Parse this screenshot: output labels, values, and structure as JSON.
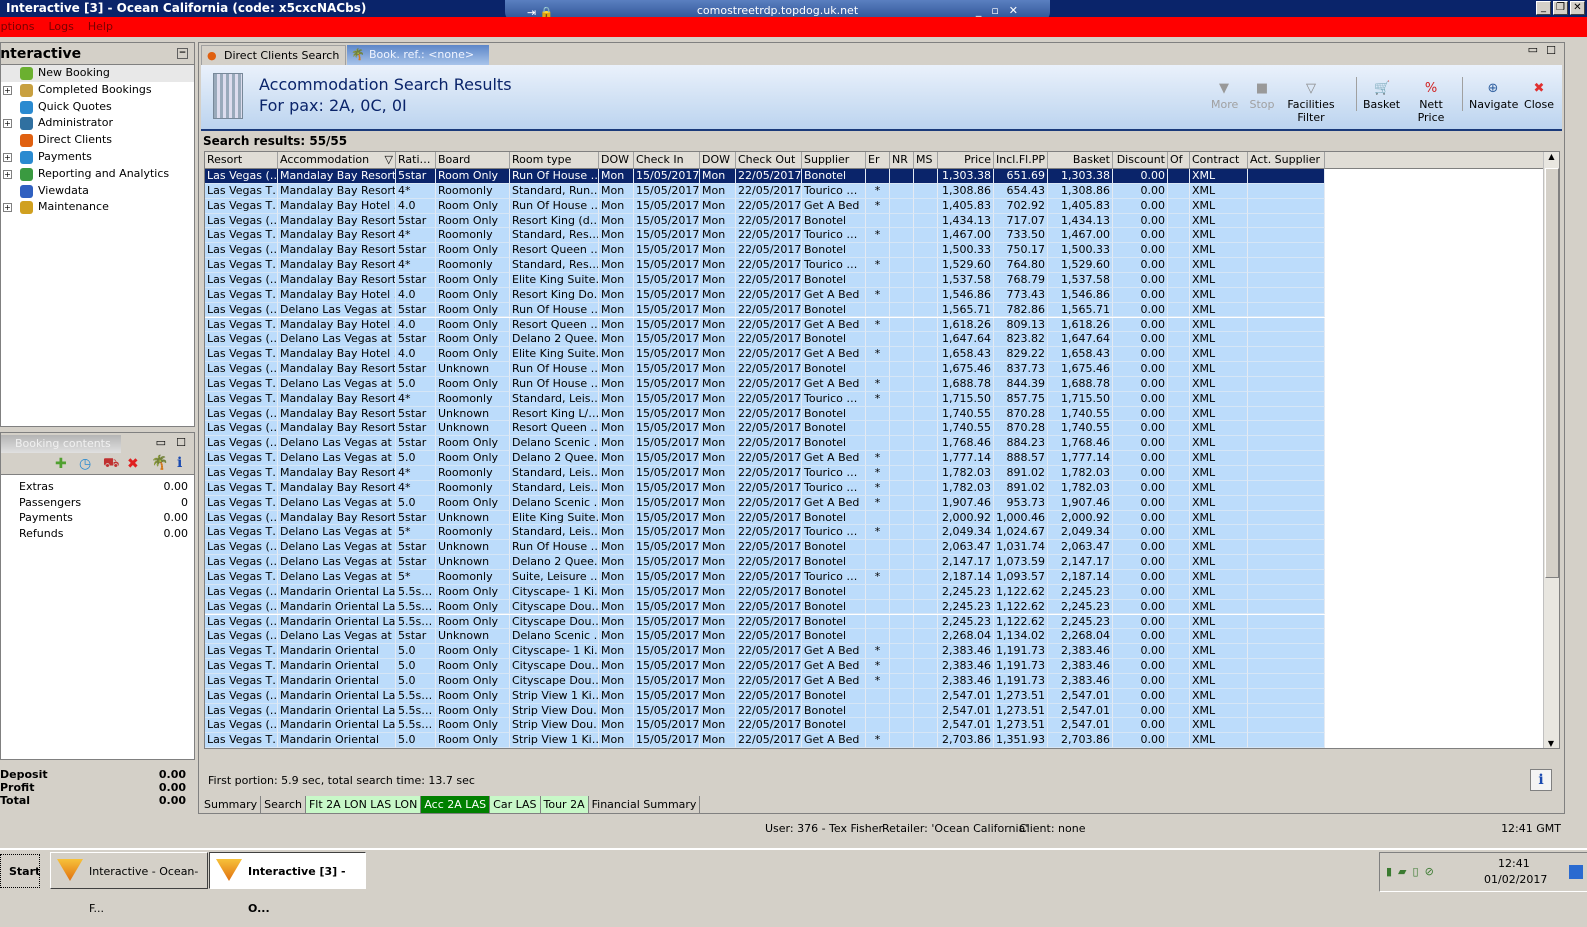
{
  "window": {
    "title": "Interactive [3] - Ocean California (code: x5cxcNACbs)",
    "rdp_host": "comostreetrdp.topdog.uk.net"
  },
  "menu": [
    "Options",
    "Logs",
    "Help"
  ],
  "sidebar": {
    "title": "Interactive",
    "items": [
      {
        "label": "New Booking",
        "expandable": false,
        "icon": "palm-tree-icon"
      },
      {
        "label": "Completed Bookings",
        "expandable": true,
        "icon": "palm-tree-money-icon"
      },
      {
        "label": "Quick Quotes",
        "expandable": false,
        "icon": "clock-globe-icon"
      },
      {
        "label": "Administrator",
        "expandable": true,
        "icon": "runner-icon"
      },
      {
        "label": "Direct Clients",
        "expandable": false,
        "icon": "person-icon"
      },
      {
        "label": "Payments",
        "expandable": true,
        "icon": "dollar-card-icon"
      },
      {
        "label": "Reporting and Analytics",
        "expandable": true,
        "icon": "report-icon"
      },
      {
        "label": "Viewdata",
        "expandable": false,
        "icon": "globe-icon"
      },
      {
        "label": "Maintenance",
        "expandable": true,
        "icon": "box-icon"
      }
    ]
  },
  "booking_contents": {
    "tab": "Booking contents",
    "rows": [
      [
        "Extras",
        "0.00"
      ],
      [
        "Passengers",
        "0"
      ],
      [
        "Payments",
        "0.00"
      ],
      [
        "Refunds",
        "0.00"
      ]
    ]
  },
  "totals": [
    [
      "Deposit",
      "0.00"
    ],
    [
      "Profit",
      "0.00"
    ],
    [
      "Total",
      "0.00"
    ]
  ],
  "tabs": [
    {
      "label": "Direct Clients Search",
      "active": false
    },
    {
      "label": "Book. ref.: <none>",
      "active": true
    }
  ],
  "header": {
    "title": "Accommodation Search Results",
    "subtitle": "For pax: 2A, 0C, 0I"
  },
  "toolbar": [
    {
      "label": "More",
      "icon": "chevron-down-icon",
      "enabled": false
    },
    {
      "label": "Stop",
      "icon": "stop-icon",
      "enabled": false
    },
    {
      "label": "Facilities Filter",
      "icon": "filter-icon",
      "enabled": true
    },
    {
      "label": "Basket",
      "icon": "basket-icon",
      "enabled": true
    },
    {
      "label": "Nett Price",
      "icon": "nett-price-icon",
      "enabled": true
    },
    {
      "label": "Navigate",
      "icon": "compass-icon",
      "enabled": true
    },
    {
      "label": "Close",
      "icon": "close-icon",
      "enabled": true
    }
  ],
  "search_results": "Search results: 55/55",
  "columns": [
    "Resort",
    "Accommodation",
    "Rati…",
    "Board",
    "Room type",
    "DOW",
    "Check In",
    "DOW",
    "Check Out",
    "Supplier",
    "Er",
    "NR",
    "MS",
    "Price",
    "Incl.Fl.PP",
    "Basket",
    "Discount",
    "Of",
    "Contract",
    "Act. Supplier"
  ],
  "rows": [
    [
      "Las Vegas (…",
      "Mandalay Bay Resort…",
      "5star",
      "Room Only",
      "Run Of House …",
      "Mon",
      "15/05/2017",
      "Mon",
      "22/05/2017",
      "Bonotel",
      "",
      "",
      "",
      "1,303.38",
      "651.69",
      "1,303.38",
      "0.00",
      "",
      "XML",
      ""
    ],
    [
      "Las Vegas T…",
      "Mandalay Bay Resort",
      "4*",
      "Roomonly",
      "Standard, Run…",
      "Mon",
      "15/05/2017",
      "Mon",
      "22/05/2017",
      "Tourico …",
      "*",
      "",
      "",
      "1,308.86",
      "654.43",
      "1,308.86",
      "0.00",
      "",
      "XML",
      ""
    ],
    [
      "Las Vegas T…",
      "Mandalay Bay Hotel …",
      "4.0",
      "Room Only",
      "Run Of House …",
      "Mon",
      "15/05/2017",
      "Mon",
      "22/05/2017",
      "Get A Bed",
      "*",
      "",
      "",
      "1,405.83",
      "702.92",
      "1,405.83",
      "0.00",
      "",
      "XML",
      ""
    ],
    [
      "Las Vegas (…",
      "Mandalay Bay Resort…",
      "5star",
      "Room Only",
      "Resort King (d…",
      "Mon",
      "15/05/2017",
      "Mon",
      "22/05/2017",
      "Bonotel",
      "",
      "",
      "",
      "1,434.13",
      "717.07",
      "1,434.13",
      "0.00",
      "",
      "XML",
      ""
    ],
    [
      "Las Vegas T…",
      "Mandalay Bay Resort",
      "4*",
      "Roomonly",
      "Standard, Res…",
      "Mon",
      "15/05/2017",
      "Mon",
      "22/05/2017",
      "Tourico …",
      "*",
      "",
      "",
      "1,467.00",
      "733.50",
      "1,467.00",
      "0.00",
      "",
      "XML",
      ""
    ],
    [
      "Las Vegas (…",
      "Mandalay Bay Resort…",
      "5star",
      "Room Only",
      "Resort Queen …",
      "Mon",
      "15/05/2017",
      "Mon",
      "22/05/2017",
      "Bonotel",
      "",
      "",
      "",
      "1,500.33",
      "750.17",
      "1,500.33",
      "0.00",
      "",
      "XML",
      ""
    ],
    [
      "Las Vegas T…",
      "Mandalay Bay Resort",
      "4*",
      "Roomonly",
      "Standard, Res…",
      "Mon",
      "15/05/2017",
      "Mon",
      "22/05/2017",
      "Tourico …",
      "*",
      "",
      "",
      "1,529.60",
      "764.80",
      "1,529.60",
      "0.00",
      "",
      "XML",
      ""
    ],
    [
      "Las Vegas (…",
      "Mandalay Bay Resort…",
      "5star",
      "Room Only",
      "Elite King Suite…",
      "Mon",
      "15/05/2017",
      "Mon",
      "22/05/2017",
      "Bonotel",
      "",
      "",
      "",
      "1,537.58",
      "768.79",
      "1,537.58",
      "0.00",
      "",
      "XML",
      ""
    ],
    [
      "Las Vegas T…",
      "Mandalay Bay Hotel …",
      "4.0",
      "Room Only",
      "Resort King Do…",
      "Mon",
      "15/05/2017",
      "Mon",
      "22/05/2017",
      "Get A Bed",
      "*",
      "",
      "",
      "1,546.86",
      "773.43",
      "1,546.86",
      "0.00",
      "",
      "XML",
      ""
    ],
    [
      "Las Vegas (…",
      "Delano Las Vegas at …",
      "5star",
      "Room Only",
      "Run Of House …",
      "Mon",
      "15/05/2017",
      "Mon",
      "22/05/2017",
      "Bonotel",
      "",
      "",
      "",
      "1,565.71",
      "782.86",
      "1,565.71",
      "0.00",
      "",
      "XML",
      ""
    ],
    [
      "Las Vegas T…",
      "Mandalay Bay Hotel …",
      "4.0",
      "Room Only",
      "Resort Queen …",
      "Mon",
      "15/05/2017",
      "Mon",
      "22/05/2017",
      "Get A Bed",
      "*",
      "",
      "",
      "1,618.26",
      "809.13",
      "1,618.26",
      "0.00",
      "",
      "XML",
      ""
    ],
    [
      "Las Vegas (…",
      "Delano Las Vegas at …",
      "5star",
      "Room Only",
      "Delano 2 Quee…",
      "Mon",
      "15/05/2017",
      "Mon",
      "22/05/2017",
      "Bonotel",
      "",
      "",
      "",
      "1,647.64",
      "823.82",
      "1,647.64",
      "0.00",
      "",
      "XML",
      ""
    ],
    [
      "Las Vegas T…",
      "Mandalay Bay Hotel …",
      "4.0",
      "Room Only",
      "Elite King Suite…",
      "Mon",
      "15/05/2017",
      "Mon",
      "22/05/2017",
      "Get A Bed",
      "*",
      "",
      "",
      "1,658.43",
      "829.22",
      "1,658.43",
      "0.00",
      "",
      "XML",
      ""
    ],
    [
      "Las Vegas (…",
      "Mandalay Bay Resort…",
      "5star",
      "Unknown",
      "Run Of House …",
      "Mon",
      "15/05/2017",
      "Mon",
      "22/05/2017",
      "Bonotel",
      "",
      "",
      "",
      "1,675.46",
      "837.73",
      "1,675.46",
      "0.00",
      "",
      "XML",
      ""
    ],
    [
      "Las Vegas T…",
      "Delano Las Vegas at …",
      "5.0",
      "Room Only",
      "Run Of House …",
      "Mon",
      "15/05/2017",
      "Mon",
      "22/05/2017",
      "Get A Bed",
      "*",
      "",
      "",
      "1,688.78",
      "844.39",
      "1,688.78",
      "0.00",
      "",
      "XML",
      ""
    ],
    [
      "Las Vegas T…",
      "Mandalay Bay Resort",
      "4*",
      "Roomonly",
      "Standard, Leis…",
      "Mon",
      "15/05/2017",
      "Mon",
      "22/05/2017",
      "Tourico …",
      "*",
      "",
      "",
      "1,715.50",
      "857.75",
      "1,715.50",
      "0.00",
      "",
      "XML",
      ""
    ],
    [
      "Las Vegas (…",
      "Mandalay Bay Resort…",
      "5star",
      "Unknown",
      "Resort King L/…",
      "Mon",
      "15/05/2017",
      "Mon",
      "22/05/2017",
      "Bonotel",
      "",
      "",
      "",
      "1,740.55",
      "870.28",
      "1,740.55",
      "0.00",
      "",
      "XML",
      ""
    ],
    [
      "Las Vegas (…",
      "Mandalay Bay Resort…",
      "5star",
      "Unknown",
      "Resort Queen …",
      "Mon",
      "15/05/2017",
      "Mon",
      "22/05/2017",
      "Bonotel",
      "",
      "",
      "",
      "1,740.55",
      "870.28",
      "1,740.55",
      "0.00",
      "",
      "XML",
      ""
    ],
    [
      "Las Vegas (…",
      "Delano Las Vegas at …",
      "5star",
      "Room Only",
      "Delano Scenic …",
      "Mon",
      "15/05/2017",
      "Mon",
      "22/05/2017",
      "Bonotel",
      "",
      "",
      "",
      "1,768.46",
      "884.23",
      "1,768.46",
      "0.00",
      "",
      "XML",
      ""
    ],
    [
      "Las Vegas T…",
      "Delano Las Vegas at …",
      "5.0",
      "Room Only",
      "Delano 2 Quee…",
      "Mon",
      "15/05/2017",
      "Mon",
      "22/05/2017",
      "Get A Bed",
      "*",
      "",
      "",
      "1,777.14",
      "888.57",
      "1,777.14",
      "0.00",
      "",
      "XML",
      ""
    ],
    [
      "Las Vegas T…",
      "Mandalay Bay Resort",
      "4*",
      "Roomonly",
      "Standard, Leis…",
      "Mon",
      "15/05/2017",
      "Mon",
      "22/05/2017",
      "Tourico …",
      "*",
      "",
      "",
      "1,782.03",
      "891.02",
      "1,782.03",
      "0.00",
      "",
      "XML",
      ""
    ],
    [
      "Las Vegas T…",
      "Mandalay Bay Resort",
      "4*",
      "Roomonly",
      "Standard, Leis…",
      "Mon",
      "15/05/2017",
      "Mon",
      "22/05/2017",
      "Tourico …",
      "*",
      "",
      "",
      "1,782.03",
      "891.02",
      "1,782.03",
      "0.00",
      "",
      "XML",
      ""
    ],
    [
      "Las Vegas T…",
      "Delano Las Vegas at …",
      "5.0",
      "Room Only",
      "Delano Scenic …",
      "Mon",
      "15/05/2017",
      "Mon",
      "22/05/2017",
      "Get A Bed",
      "*",
      "",
      "",
      "1,907.46",
      "953.73",
      "1,907.46",
      "0.00",
      "",
      "XML",
      ""
    ],
    [
      "Las Vegas (…",
      "Mandalay Bay Resort…",
      "5star",
      "Unknown",
      "Elite King Suite…",
      "Mon",
      "15/05/2017",
      "Mon",
      "22/05/2017",
      "Bonotel",
      "",
      "",
      "",
      "2,000.92",
      "1,000.46",
      "2,000.92",
      "0.00",
      "",
      "XML",
      ""
    ],
    [
      "Las Vegas T…",
      "Delano Las Vegas at …",
      "5*",
      "Roomonly",
      "Standard, Leis…",
      "Mon",
      "15/05/2017",
      "Mon",
      "22/05/2017",
      "Tourico …",
      "*",
      "",
      "",
      "2,049.34",
      "1,024.67",
      "2,049.34",
      "0.00",
      "",
      "XML",
      ""
    ],
    [
      "Las Vegas (…",
      "Delano Las Vegas at …",
      "5star",
      "Unknown",
      "Run Of House …",
      "Mon",
      "15/05/2017",
      "Mon",
      "22/05/2017",
      "Bonotel",
      "",
      "",
      "",
      "2,063.47",
      "1,031.74",
      "2,063.47",
      "0.00",
      "",
      "XML",
      ""
    ],
    [
      "Las Vegas (…",
      "Delano Las Vegas at …",
      "5star",
      "Unknown",
      "Delano 2 Quee…",
      "Mon",
      "15/05/2017",
      "Mon",
      "22/05/2017",
      "Bonotel",
      "",
      "",
      "",
      "2,147.17",
      "1,073.59",
      "2,147.17",
      "0.00",
      "",
      "XML",
      ""
    ],
    [
      "Las Vegas T…",
      "Delano Las Vegas at …",
      "5*",
      "Roomonly",
      "Suite, Leisure …",
      "Mon",
      "15/05/2017",
      "Mon",
      "22/05/2017",
      "Tourico …",
      "*",
      "",
      "",
      "2,187.14",
      "1,093.57",
      "2,187.14",
      "0.00",
      "",
      "XML",
      ""
    ],
    [
      "Las Vegas (…",
      "Mandarin Oriental La…",
      "5.5s…",
      "Room Only",
      "Cityscape- 1 Ki…",
      "Mon",
      "15/05/2017",
      "Mon",
      "22/05/2017",
      "Bonotel",
      "",
      "",
      "",
      "2,245.23",
      "1,122.62",
      "2,245.23",
      "0.00",
      "",
      "XML",
      ""
    ],
    [
      "Las Vegas (…",
      "Mandarin Oriental La…",
      "5.5s…",
      "Room Only",
      "Cityscape Dou…",
      "Mon",
      "15/05/2017",
      "Mon",
      "22/05/2017",
      "Bonotel",
      "",
      "",
      "",
      "2,245.23",
      "1,122.62",
      "2,245.23",
      "0.00",
      "",
      "XML",
      ""
    ],
    [
      "Las Vegas (…",
      "Mandarin Oriental La…",
      "5.5s…",
      "Room Only",
      "Cityscape Dou…",
      "Mon",
      "15/05/2017",
      "Mon",
      "22/05/2017",
      "Bonotel",
      "",
      "",
      "",
      "2,245.23",
      "1,122.62",
      "2,245.23",
      "0.00",
      "",
      "XML",
      ""
    ],
    [
      "Las Vegas (…",
      "Delano Las Vegas at …",
      "5star",
      "Unknown",
      "Delano Scenic …",
      "Mon",
      "15/05/2017",
      "Mon",
      "22/05/2017",
      "Bonotel",
      "",
      "",
      "",
      "2,268.04",
      "1,134.02",
      "2,268.04",
      "0.00",
      "",
      "XML",
      ""
    ],
    [
      "Las Vegas T…",
      "Mandarin Oriental",
      "5.0",
      "Room Only",
      "Cityscape- 1 Ki…",
      "Mon",
      "15/05/2017",
      "Mon",
      "22/05/2017",
      "Get A Bed",
      "*",
      "",
      "",
      "2,383.46",
      "1,191.73",
      "2,383.46",
      "0.00",
      "",
      "XML",
      ""
    ],
    [
      "Las Vegas T…",
      "Mandarin Oriental",
      "5.0",
      "Room Only",
      "Cityscape Dou…",
      "Mon",
      "15/05/2017",
      "Mon",
      "22/05/2017",
      "Get A Bed",
      "*",
      "",
      "",
      "2,383.46",
      "1,191.73",
      "2,383.46",
      "0.00",
      "",
      "XML",
      ""
    ],
    [
      "Las Vegas T…",
      "Mandarin Oriental",
      "5.0",
      "Room Only",
      "Cityscape Dou…",
      "Mon",
      "15/05/2017",
      "Mon",
      "22/05/2017",
      "Get A Bed",
      "*",
      "",
      "",
      "2,383.46",
      "1,191.73",
      "2,383.46",
      "0.00",
      "",
      "XML",
      ""
    ],
    [
      "Las Vegas (…",
      "Mandarin Oriental La…",
      "5.5s…",
      "Room Only",
      "Strip View 1 Ki…",
      "Mon",
      "15/05/2017",
      "Mon",
      "22/05/2017",
      "Bonotel",
      "",
      "",
      "",
      "2,547.01",
      "1,273.51",
      "2,547.01",
      "0.00",
      "",
      "XML",
      ""
    ],
    [
      "Las Vegas (…",
      "Mandarin Oriental La…",
      "5.5s…",
      "Room Only",
      "Strip View Dou…",
      "Mon",
      "15/05/2017",
      "Mon",
      "22/05/2017",
      "Bonotel",
      "",
      "",
      "",
      "2,547.01",
      "1,273.51",
      "2,547.01",
      "0.00",
      "",
      "XML",
      ""
    ],
    [
      "Las Vegas (…",
      "Mandarin Oriental La…",
      "5.5s…",
      "Room Only",
      "Strip View Dou…",
      "Mon",
      "15/05/2017",
      "Mon",
      "22/05/2017",
      "Bonotel",
      "",
      "",
      "",
      "2,547.01",
      "1,273.51",
      "2,547.01",
      "0.00",
      "",
      "XML",
      ""
    ],
    [
      "Las Vegas T…",
      "Mandarin Oriental",
      "5.0",
      "Room Only",
      "Strip View 1 Ki…",
      "Mon",
      "15/05/2017",
      "Mon",
      "22/05/2017",
      "Get A Bed",
      "*",
      "",
      "",
      "2,703.86",
      "1,351.93",
      "2,703.86",
      "0.00",
      "",
      "XML",
      ""
    ]
  ],
  "selected_row": 0,
  "footer": "First portion: 5.9 sec, total search time: 13.7 sec",
  "bottom_tabs": [
    {
      "label": "Summary",
      "state": "normal"
    },
    {
      "label": "Search",
      "state": "normal"
    },
    {
      "label": "Flt 2A LON LAS LON",
      "state": "light"
    },
    {
      "label": "Acc 2A LAS",
      "state": "active"
    },
    {
      "label": "Car LAS",
      "state": "light"
    },
    {
      "label": "Tour 2A",
      "state": "light"
    },
    {
      "label": "Financial Summary",
      "state": "normal"
    }
  ],
  "status": {
    "user": "User: 376 - Tex Fisher",
    "retailer": "Retailer: 'Ocean California'",
    "client": "Client: none",
    "time": "12:41 GMT"
  },
  "taskbar": {
    "start": "Start",
    "tasks": [
      "Interactive - Ocean-F...",
      "Interactive [3] - O..."
    ],
    "clock": "12:41",
    "date": "01/02/2017"
  },
  "colors": {
    "title": "#0a246a",
    "menu": "#ff0000",
    "row": "#bcdcfb",
    "selected": "#0a246a",
    "tab_active": "#008000",
    "tab_light": "#c8f8c8"
  }
}
